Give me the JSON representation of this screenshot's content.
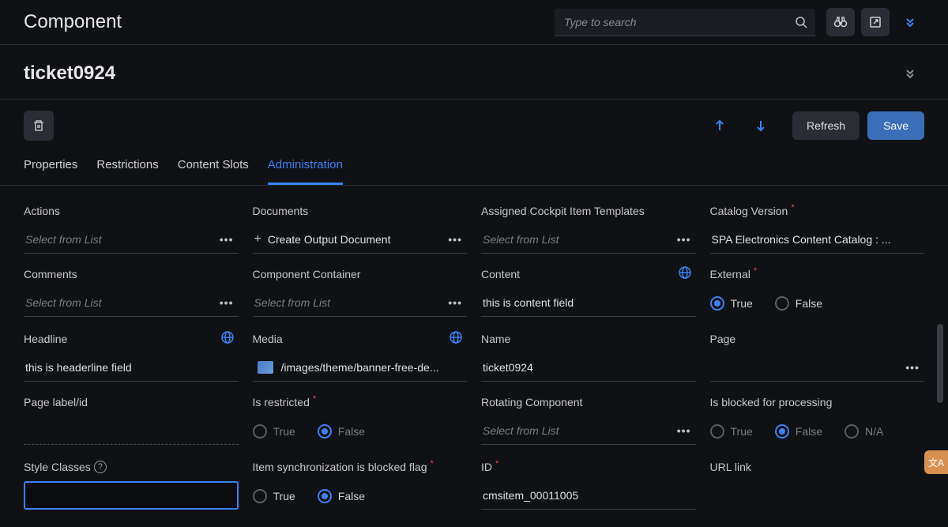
{
  "header": {
    "title": "Component",
    "search_placeholder": "Type to search"
  },
  "subheader": {
    "title": "ticket0924"
  },
  "toolbar": {
    "refresh": "Refresh",
    "save": "Save"
  },
  "tabs": {
    "properties": "Properties",
    "restrictions": "Restrictions",
    "content_slots": "Content Slots",
    "administration": "Administration"
  },
  "fields": {
    "actions": {
      "label": "Actions",
      "placeholder": "Select from List"
    },
    "documents": {
      "label": "Documents",
      "action": "Create Output Document"
    },
    "assigned_templates": {
      "label": "Assigned Cockpit Item Templates",
      "placeholder": "Select from List"
    },
    "catalog_version": {
      "label": "Catalog Version",
      "value": "SPA Electronics Content Catalog : ..."
    },
    "comments": {
      "label": "Comments",
      "placeholder": "Select from List"
    },
    "component_container": {
      "label": "Component Container",
      "placeholder": "Select from List"
    },
    "content": {
      "label": "Content",
      "value": "this is content field"
    },
    "external": {
      "label": "External"
    },
    "headline": {
      "label": "Headline",
      "value": "this is headerline field"
    },
    "media": {
      "label": "Media",
      "value": "/images/theme/banner-free-de..."
    },
    "name": {
      "label": "Name",
      "value": "ticket0924"
    },
    "page": {
      "label": "Page"
    },
    "page_label_id": {
      "label": "Page label/id"
    },
    "is_restricted": {
      "label": "Is restricted"
    },
    "rotating_component": {
      "label": "Rotating Component",
      "placeholder": "Select from List"
    },
    "is_blocked": {
      "label": "Is blocked for processing"
    },
    "style_classes": {
      "label": "Style Classes"
    },
    "item_sync": {
      "label": "Item synchronization is blocked flag"
    },
    "id": {
      "label": "ID",
      "value": "cmsitem_00011005"
    },
    "url_link": {
      "label": "URL link"
    }
  },
  "radio": {
    "true": "True",
    "false": "False",
    "na": "N/A"
  }
}
